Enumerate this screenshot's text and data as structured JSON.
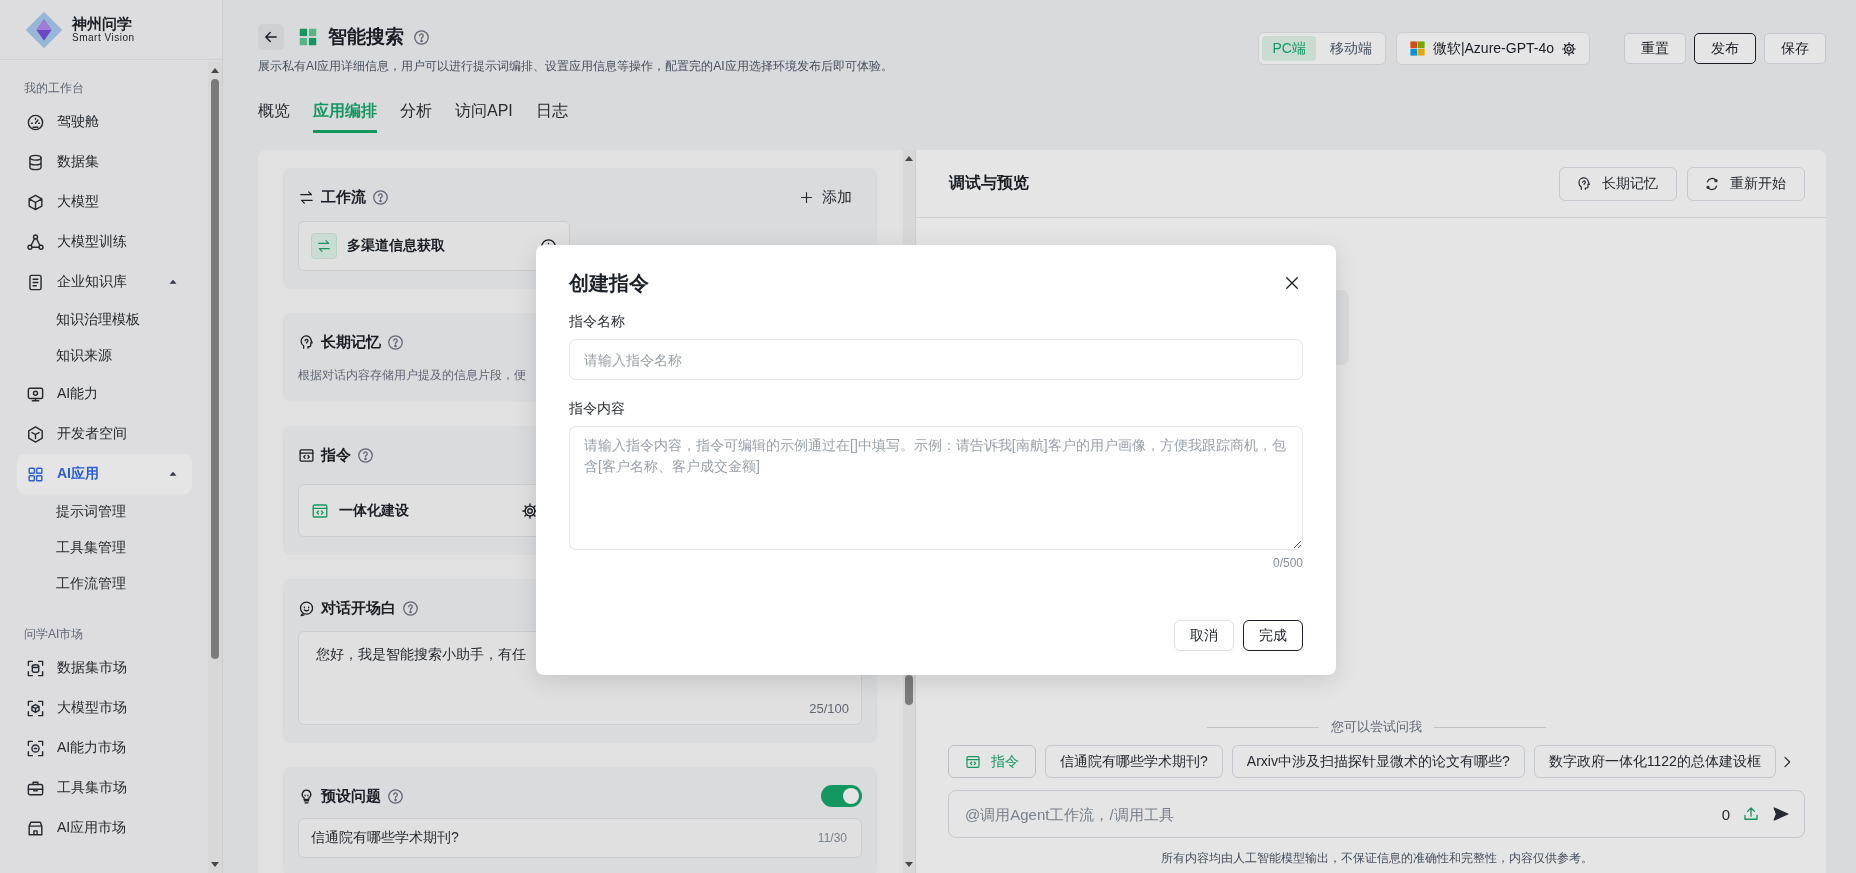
{
  "sidebar": {
    "logo": {
      "name": "神州问学",
      "subtitle": "Smart Vision"
    },
    "sections": [
      {
        "title": "我的工作台",
        "items": [
          {
            "label": "驾驶舱",
            "selected": false
          },
          {
            "label": "数据集",
            "selected": false
          },
          {
            "label": "大模型",
            "selected": false
          },
          {
            "label": "大模型训练",
            "selected": false
          },
          {
            "label": "企业知识库",
            "selected": false,
            "expanded": true,
            "children": [
              {
                "label": "知识治理模板",
                "selected": false
              },
              {
                "label": "知识来源",
                "selected": false
              }
            ]
          },
          {
            "label": "AI能力",
            "selected": false
          },
          {
            "label": "开发者空间",
            "selected": false
          },
          {
            "label": "AI应用",
            "selected": true,
            "expanded": true,
            "children": [
              {
                "label": "提示词管理",
                "selected": false
              },
              {
                "label": "工具集管理",
                "selected": false
              },
              {
                "label": "工作流管理",
                "selected": false
              }
            ]
          }
        ]
      },
      {
        "title": "问学AI市场",
        "items": [
          {
            "label": "数据集市场",
            "selected": false
          },
          {
            "label": "大模型市场",
            "selected": false
          },
          {
            "label": "AI能力市场",
            "selected": false
          },
          {
            "label": "工具集市场",
            "selected": false
          },
          {
            "label": "AI应用市场",
            "selected": false
          }
        ]
      }
    ]
  },
  "header": {
    "title": "智能搜索",
    "description": "展示私有AI应用详细信息，用户可以进行提示词编排、设置应用信息等操作，配置完的AI应用选择环境发布后即可体验。",
    "platforms": [
      {
        "label": "PC端",
        "selected": true
      },
      {
        "label": "移动端",
        "selected": false
      }
    ],
    "model": "微软|Azure-GPT-4o",
    "buttons": [
      {
        "label": "重置",
        "kind": "default"
      },
      {
        "label": "发布",
        "kind": "primary"
      },
      {
        "label": "保存",
        "kind": "default"
      }
    ]
  },
  "tabs": [
    {
      "label": "概览",
      "selected": false
    },
    {
      "label": "应用编排",
      "selected": true
    },
    {
      "label": "分析",
      "selected": false
    },
    {
      "label": "访问API",
      "selected": false
    },
    {
      "label": "日志",
      "selected": false
    }
  ],
  "editor": {
    "workflow": {
      "title": "工作流",
      "add": "添加",
      "items": [
        {
          "name": "多渠道信息获取"
        }
      ]
    },
    "memory": {
      "title": "长期记忆",
      "description": "根据对话内容存储用户提及的信息片段，便"
    },
    "commands": {
      "title": "指令",
      "items": [
        {
          "name": "一体化建设"
        }
      ]
    },
    "opening": {
      "title": "对话开场白",
      "value": "您好，我是智能搜索小助手，有任",
      "count": "25/100"
    },
    "preset": {
      "title": "预设问题",
      "on": true,
      "questions": [
        {
          "value": "信通院有哪些学术期刊?",
          "count": "11/30"
        }
      ]
    }
  },
  "preview": {
    "title": "调试与预览",
    "buttons": [
      {
        "label": "长期记忆",
        "kind": "memory"
      },
      {
        "label": "重新开始",
        "kind": "restart"
      }
    ],
    "suggest_label": "您可以尝试问我",
    "suggestions": [
      {
        "kind": "command",
        "label": "指令"
      },
      {
        "kind": "question",
        "label": "信通院有哪些学术期刊?"
      },
      {
        "kind": "question",
        "label": "Arxiv中涉及扫描探针显微术的论文有哪些?"
      },
      {
        "kind": "question",
        "label": "数字政府一体化1122的总体建设框"
      }
    ],
    "input": {
      "placeholder": "@调用Agent工作流，/调用工具",
      "count": "0"
    },
    "disclaimer": "所有内容均由人工智能模型输出，不保证信息的准确性和完整性，内容仅供参考。"
  },
  "dialog": {
    "title": "创建指令",
    "fields": [
      {
        "kind": "input",
        "label": "指令名称",
        "placeholder": "请输入指令名称"
      },
      {
        "kind": "textarea",
        "label": "指令内容",
        "placeholder": "请输入指令内容，指令可编辑的示例通过在[]中填写。示例：请告诉我[南航]客户的用户画像，方便我跟踪商机，包含[客户名称、客户成交金额]",
        "count": "0/500"
      }
    ],
    "buttons": [
      {
        "label": "取消",
        "kind": "default"
      },
      {
        "label": "完成",
        "kind": "primary"
      }
    ]
  }
}
